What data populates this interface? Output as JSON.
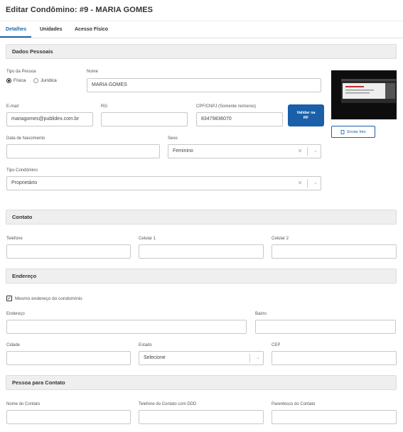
{
  "page": {
    "title": "Editar Condômino: #9 - MARIA GOMES"
  },
  "tabs": [
    {
      "label": "Detalhes"
    },
    {
      "label": "Unidades"
    },
    {
      "label": "Acesso Físico"
    }
  ],
  "sections": {
    "dados_pessoais": "Dados Pessoais",
    "contato": "Contato",
    "endereco": "Endereço",
    "pessoa_contato": "Pessoa para Contato"
  },
  "dados": {
    "tipo_pessoa_label": "Tipo da Pessoa",
    "tipo_fisica": "Física",
    "tipo_juridica": "Jurídica",
    "tipo_selected": "Física",
    "nome_label": "Nome",
    "nome_value": "MARIA GOMES",
    "email_label": "E-mail",
    "email_value": "mariagomes@publidex.com.br",
    "rg_label": "RG",
    "rg_value": "",
    "cpf_label": "CPF/CNPJ (Somente números)",
    "cpf_value": "83479836070",
    "validar_label": "Validar na RF",
    "enviar_foto_label": "Enviar foto",
    "nascimento_label": "Data de Nascimento",
    "nascimento_value": "",
    "sexo_label": "Sexo",
    "sexo_value": "Feminino",
    "tipo_condomino_label": "Tipo Condômino",
    "tipo_condomino_value": "Proprietário"
  },
  "contato": {
    "telefone_label": "Telefone",
    "celular1_label": "Celular 1",
    "celular2_label": "Celular 2"
  },
  "endereco": {
    "mesmo_endereco_label": "Mesmo endereço do condomínio",
    "mesmo_endereco_checked": true,
    "endereco_label": "Endereço",
    "bairro_label": "Bairro",
    "cidade_label": "Cidade",
    "estado_label": "Estado",
    "estado_value": "Selecione",
    "cep_label": "CEP"
  },
  "pessoa_contato": {
    "nome_label": "Nome do Contato",
    "telefone_label": "Telefone do Contato com DDD",
    "parentesco_label": "Parentesco do Contato"
  }
}
